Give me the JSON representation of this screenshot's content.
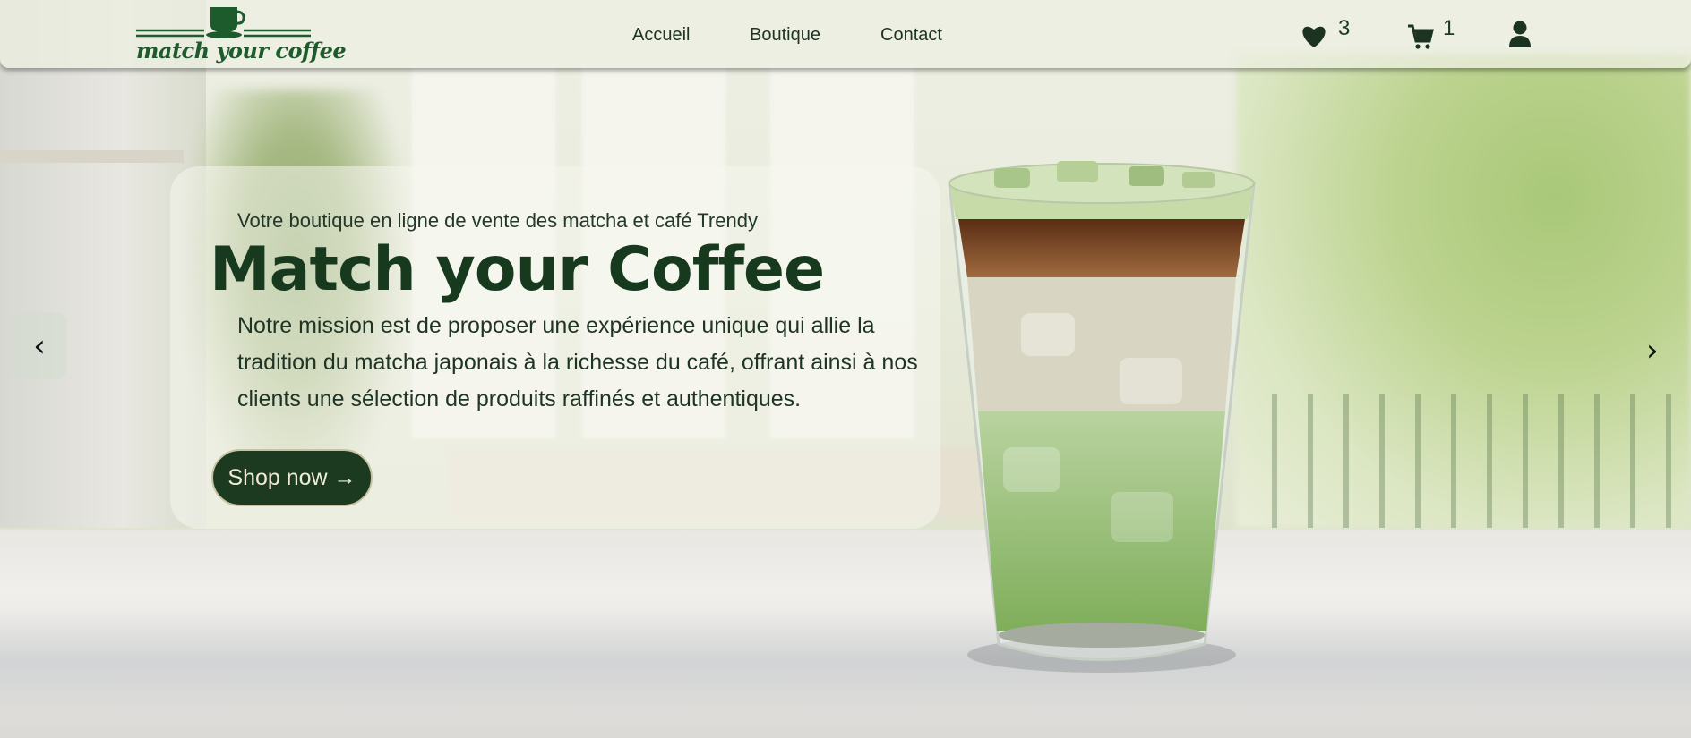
{
  "header": {
    "logo_text": "match your coffee",
    "nav": [
      "Accueil",
      "Boutique",
      "Contact"
    ],
    "wishlist_count": "3",
    "cart_count": "1",
    "icons": [
      "heart-icon",
      "cart-icon",
      "user-icon"
    ]
  },
  "hero": {
    "tagline": "Votre boutique en ligne de vente des matcha et café Trendy",
    "title": "Match your Coffee",
    "mission": "Notre mission est de proposer une expérience unique qui allie la tradition du matcha japonais à la richesse du café, offrant ainsi à nos clients une sélection de produits raffinés et authentiques.",
    "cta": "Shop now →"
  },
  "carousel": {
    "prev": "‹",
    "next": "›"
  },
  "colors": {
    "brand_green": "#1c3a20",
    "matcha": "#8fb56a",
    "coffee": "#6e3a1c"
  }
}
